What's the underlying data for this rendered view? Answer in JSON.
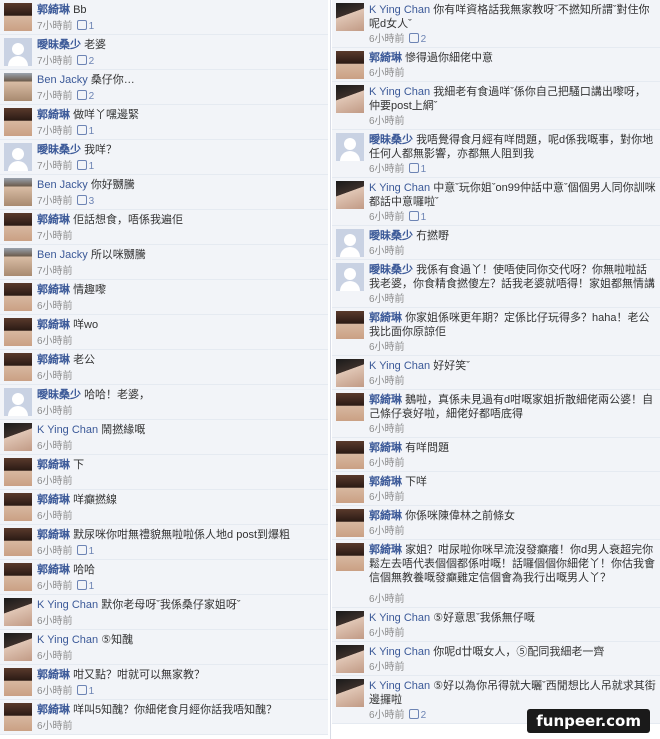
{
  "left": [
    {
      "id": "l1",
      "author": "郭綺琳",
      "text": "Bb",
      "time": "7小時前",
      "likes": "1",
      "avatar": "photo-a"
    },
    {
      "id": "l2",
      "author": "曖昧桑少",
      "text": "老婆",
      "time": "7小時前",
      "likes": "2",
      "avatar": "blank"
    },
    {
      "id": "l3",
      "author": "Ben Jacky",
      "text": "桑仔你…",
      "time": "7小時前",
      "likes": "2",
      "avatar": "photo-m",
      "en": true
    },
    {
      "id": "l4",
      "author": "郭綺琳",
      "text": "做咩丫嘿邊緊",
      "time": "7小時前",
      "likes": "1",
      "avatar": "photo-a"
    },
    {
      "id": "l5",
      "author": "曖昧桑少",
      "text": "我咩？",
      "time": "7小時前",
      "likes": "1",
      "avatar": "blank"
    },
    {
      "id": "l6",
      "author": "Ben Jacky",
      "text": "你好嬲騰",
      "time": "7小時前",
      "likes": "3",
      "avatar": "photo-m",
      "en": true
    },
    {
      "id": "l7",
      "author": "郭綺琳",
      "text": "佢話想食，唔係我遍佢",
      "time": "7小時前",
      "likes": "",
      "avatar": "photo-a"
    },
    {
      "id": "l8",
      "author": "Ben Jacky",
      "text": "所以咪嬲騰",
      "time": "7小時前",
      "likes": "",
      "avatar": "photo-m",
      "en": true
    },
    {
      "id": "l9",
      "author": "郭綺琳",
      "text": "情趣嚟",
      "time": "6小時前",
      "likes": "",
      "avatar": "photo-a"
    },
    {
      "id": "l10",
      "author": "郭綺琳",
      "text": "咩wo",
      "time": "6小時前",
      "likes": "",
      "avatar": "photo-a"
    },
    {
      "id": "l11",
      "author": "郭綺琳",
      "text": "老公",
      "time": "6小時前",
      "likes": "",
      "avatar": "photo-a"
    },
    {
      "id": "l12",
      "author": "曖昧桑少",
      "text": "哈哈！老婆，",
      "time": "6小時前",
      "likes": "",
      "avatar": "blank"
    },
    {
      "id": "l13",
      "author": "K Ying Chan",
      "text": "鬧撚緣嘅",
      "time": "6小時前",
      "likes": "",
      "avatar": "photo-b",
      "en": true
    },
    {
      "id": "l14",
      "author": "郭綺琳",
      "text": "下",
      "time": "6小時前",
      "likes": "",
      "avatar": "photo-a"
    },
    {
      "id": "l15",
      "author": "郭綺琳",
      "text": "咩癲撚線",
      "time": "6小時前",
      "likes": "",
      "avatar": "photo-a"
    },
    {
      "id": "l16",
      "author": "郭綺琳",
      "text": "默尿咪你咁無禮貌無啦啦係人地d post到爆粗",
      "time": "6小時前",
      "likes": "1",
      "avatar": "photo-a"
    },
    {
      "id": "l17",
      "author": "郭綺琳",
      "text": "哈哈",
      "time": "6小時前",
      "likes": "1",
      "avatar": "photo-a"
    },
    {
      "id": "l18",
      "author": "K Ying Chan",
      "text": "默你老母呀ˇ我係桑仔家姐呀ˇ",
      "time": "6小時前",
      "likes": "",
      "avatar": "photo-b",
      "en": true
    },
    {
      "id": "l19",
      "author": "K Ying Chan",
      "text": "⑤知醜",
      "time": "6小時前",
      "likes": "",
      "avatar": "photo-b",
      "en": true
    },
    {
      "id": "l20",
      "author": "郭綺琳",
      "text": "咁又點？咁就可以無家教？",
      "time": "6小時前",
      "likes": "1",
      "avatar": "photo-a"
    },
    {
      "id": "l21",
      "author": "郭綺琳",
      "text": "咩叫5知醜？你細佬食月經你話我唔知醜？",
      "time": "6小時前",
      "likes": "",
      "avatar": "photo-a"
    }
  ],
  "right": [
    {
      "id": "r1",
      "author": "K Ying Chan",
      "text": "你有咩資格話我無家教呀ˇ不撚知所謂ˇ對住你呢d女人ˇ",
      "time": "6小時前",
      "likes": "2",
      "avatar": "photo-b",
      "en": true
    },
    {
      "id": "r2",
      "author": "郭綺琳",
      "text": "慘得過你細佬中意",
      "time": "6小時前",
      "likes": "",
      "avatar": "photo-a"
    },
    {
      "id": "r3",
      "author": "K Ying Chan",
      "text": "我細老有食過咩ˇ係你自己把騷口講出嚟呀，仲要post上網ˇ",
      "time": "6小時前",
      "likes": "",
      "avatar": "photo-b",
      "en": true
    },
    {
      "id": "r4",
      "author": "曖昧桑少",
      "text": "我唔覺得食月經有咩問題，呢d係我嘅事，對你地任何人都無影響，亦都無人阻到我",
      "time": "6小時前",
      "likes": "1",
      "avatar": "blank"
    },
    {
      "id": "r5",
      "author": "K Ying Chan",
      "text": "中意ˇ玩你姐ˇon99仲話中意ˇ個個男人同你訓咪都話中意囉啦ˇ",
      "time": "6小時前",
      "likes": "1",
      "avatar": "photo-b",
      "en": true
    },
    {
      "id": "r6",
      "author": "曖昧桑少",
      "text": "冇撚嘢",
      "time": "6小時前",
      "likes": "",
      "avatar": "blank"
    },
    {
      "id": "r7",
      "author": "曖昧桑少",
      "text": "我係有食過丫！使唔使同你交代呀？你無啦啦話我老婆，你食精食撚傻左？話我老婆就唔得！家姐都無情講",
      "time": "6小時前",
      "likes": "",
      "avatar": "blank"
    },
    {
      "id": "r8",
      "author": "郭綺琳",
      "text": "你家姐係咪更年期？定係比仔玩得多？haha！老公我比面你原諒佢",
      "time": "6小時前",
      "likes": "",
      "avatar": "photo-a"
    },
    {
      "id": "r9",
      "author": "K Ying Chan",
      "text": "好好笑ˇ",
      "time": "6小時前",
      "likes": "",
      "avatar": "photo-b",
      "en": true
    },
    {
      "id": "r10",
      "author": "郭綺琳",
      "text": "鵝啦，真係未見過有d咁嘅家姐折散細佬兩公婆！自己條仔衰好啦，細佬好都唔底得",
      "time": "6小時前",
      "likes": "",
      "avatar": "photo-a"
    },
    {
      "id": "r11",
      "author": "郭綺琳",
      "text": "有咩問題",
      "time": "6小時前",
      "likes": "",
      "avatar": "photo-a"
    },
    {
      "id": "r12",
      "author": "郭綺琳",
      "text": "下咩",
      "time": "6小時前",
      "likes": "",
      "avatar": "photo-a"
    },
    {
      "id": "r13",
      "author": "郭綺琳",
      "text": "你係咪陳偉林之前條女",
      "time": "6小時前",
      "likes": "",
      "avatar": "photo-a"
    },
    {
      "id": "r14",
      "author": "郭綺琳",
      "text": "家姐？咁尿啦你咪早流沒發癲癢！你d男人衰超完你鬆左去唔代表個個都係咁嘅！話囉個個你細佬丫！你估我會信個無教養嘅發癲雞定信個會為我行出嘅男人丫？",
      "time": "6小時前",
      "likes": "",
      "avatar": "photo-a"
    },
    {
      "id": "r15",
      "author": "K Ying Chan",
      "text": "⑤好意思ˇ我係無仔嘅",
      "time": "6小時前",
      "likes": "",
      "avatar": "photo-b",
      "en": true
    },
    {
      "id": "r16",
      "author": "K Ying Chan",
      "text": "你呢d廿嘅女人，⑤配同我細老一齊",
      "time": "6小時前",
      "likes": "",
      "avatar": "photo-b",
      "en": true
    },
    {
      "id": "r17",
      "author": "K Ying Chan",
      "text": "⑤好以為你吊得就大曬ˇ西閒想比人吊就求其街邊攞啦",
      "time": "6小時前",
      "likes": "2",
      "avatar": "photo-b",
      "en": true
    }
  ],
  "watermark": "funpeer.com"
}
